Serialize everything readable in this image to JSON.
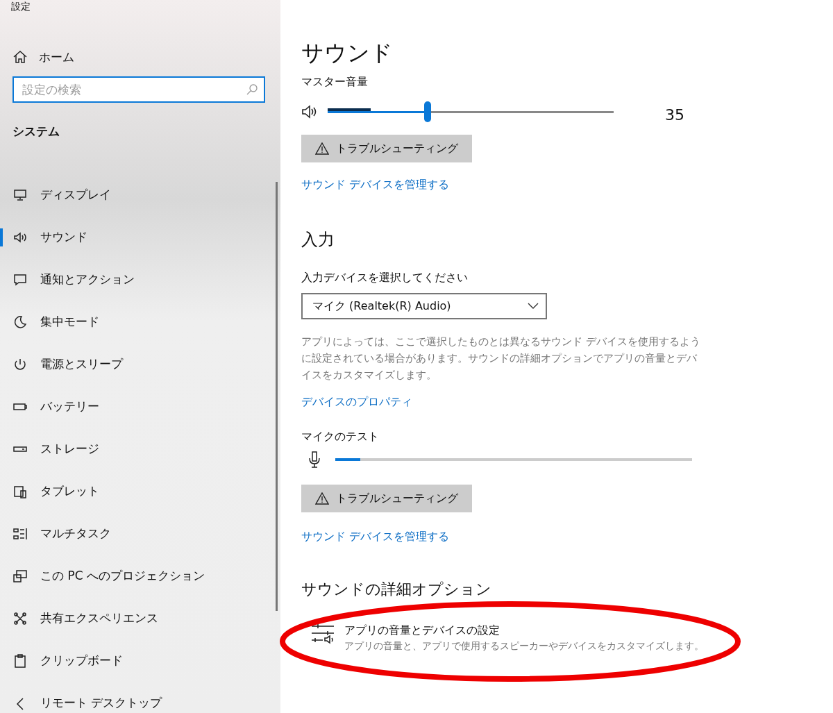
{
  "window": {
    "title": "設定"
  },
  "sidebar": {
    "home": "ホーム",
    "search": {
      "placeholder": "設定の検索"
    },
    "section": "システム",
    "items": [
      {
        "label": "ディスプレイ",
        "selected": false
      },
      {
        "label": "サウンド",
        "selected": true
      },
      {
        "label": "通知とアクション",
        "selected": false
      },
      {
        "label": "集中モード",
        "selected": false
      },
      {
        "label": "電源とスリープ",
        "selected": false
      },
      {
        "label": "バッテリー",
        "selected": false
      },
      {
        "label": "ストレージ",
        "selected": false
      },
      {
        "label": "タブレット",
        "selected": false
      },
      {
        "label": "マルチタスク",
        "selected": false
      },
      {
        "label": "この PC へのプロジェクション",
        "selected": false
      },
      {
        "label": "共有エクスペリエンス",
        "selected": false
      },
      {
        "label": "クリップボード",
        "selected": false
      },
      {
        "label": "リモート デスクトップ",
        "selected": false
      }
    ]
  },
  "page": {
    "title": "サウンド",
    "output": {
      "label": "マスター音量",
      "volume": {
        "level": 0.35,
        "reading": "35"
      },
      "meter": {
        "level": 0.15
      },
      "troubleshoot": "トラブルシューティング",
      "manage_link": "サウンド デバイスを管理する"
    },
    "input": {
      "heading": "入力",
      "select_label": "入力デバイスを選択してください",
      "device": "マイク (Realtek(R) Audio)",
      "description": "アプリによっては、ここで選択したものとは異なるサウンド デバイスを使用するように設定されている場合があります。サウンドの詳細オプションでアプリの音量とデバイスをカスタマイズします。",
      "properties_link": "デバイスのプロパティ",
      "test_label": "マイクのテスト",
      "mic_meter": {
        "level": 0.07
      },
      "troubleshoot": "トラブルシューティング",
      "manage_link": "サウンド デバイスを管理する"
    },
    "advanced": {
      "heading": "サウンドの詳細オプション",
      "item": {
        "title": "アプリの音量とデバイスの設定",
        "subtitle": "アプリの音量と、アプリで使用するスピーカーやデバイスをカスタマイズします。"
      }
    }
  },
  "highlight": {
    "kind": "ellipse"
  }
}
